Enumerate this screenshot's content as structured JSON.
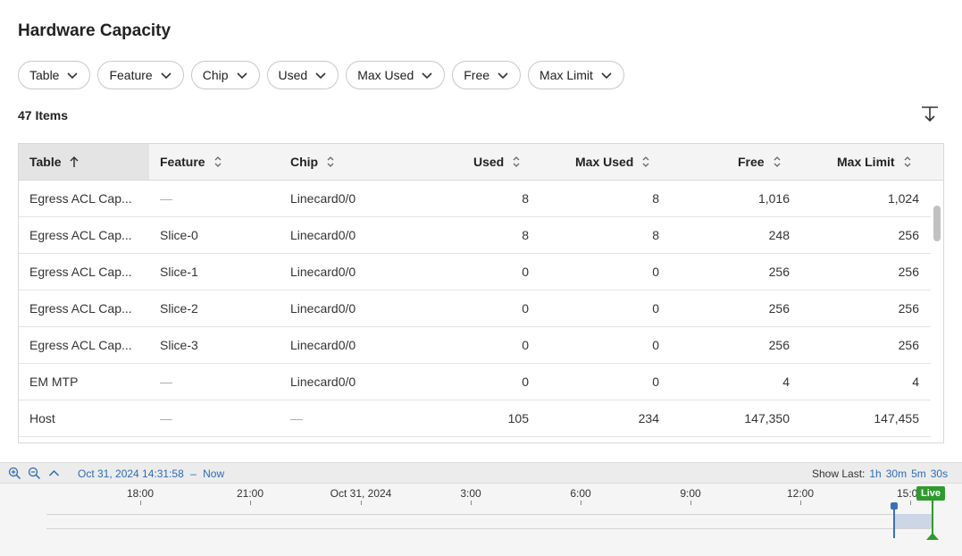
{
  "page": {
    "title": "Hardware Capacity"
  },
  "filters": [
    {
      "label": "Table"
    },
    {
      "label": "Feature"
    },
    {
      "label": "Chip"
    },
    {
      "label": "Used"
    },
    {
      "label": "Max Used"
    },
    {
      "label": "Free"
    },
    {
      "label": "Max Limit"
    }
  ],
  "items_count": "47 Items",
  "table": {
    "columns": [
      {
        "label": "Table",
        "sort": "ascending"
      },
      {
        "label": "Feature",
        "sort": "none"
      },
      {
        "label": "Chip",
        "sort": "none"
      },
      {
        "label": "Used",
        "sort": "none"
      },
      {
        "label": "Max Used",
        "sort": "none"
      },
      {
        "label": "Free",
        "sort": "none"
      },
      {
        "label": "Max Limit",
        "sort": "none"
      }
    ],
    "rows": [
      [
        "Egress ACL Cap...",
        "—",
        "Linecard0/0",
        "8",
        "8",
        "1,016",
        "1,024"
      ],
      [
        "Egress ACL Cap...",
        "Slice-0",
        "Linecard0/0",
        "8",
        "8",
        "248",
        "256"
      ],
      [
        "Egress ACL Cap...",
        "Slice-1",
        "Linecard0/0",
        "0",
        "0",
        "256",
        "256"
      ],
      [
        "Egress ACL Cap...",
        "Slice-2",
        "Linecard0/0",
        "0",
        "0",
        "256",
        "256"
      ],
      [
        "Egress ACL Cap...",
        "Slice-3",
        "Linecard0/0",
        "0",
        "0",
        "256",
        "256"
      ],
      [
        "EM MTP",
        "—",
        "Linecard0/0",
        "0",
        "0",
        "4",
        "4"
      ],
      [
        "Host",
        "—",
        "—",
        "105",
        "234",
        "147,350",
        "147,455"
      ]
    ]
  },
  "timeline": {
    "range_start": "Oct 31, 2024 14:31:58",
    "range_sep": "–",
    "range_end": "Now",
    "show_last_label": "Show Last:",
    "show_last_options": [
      "1h",
      "30m",
      "5m",
      "30s"
    ],
    "ticks": [
      "18:00",
      "21:00",
      "Oct 31, 2024",
      "3:00",
      "6:00",
      "9:00",
      "12:00",
      "15:00"
    ],
    "live_label": "Live"
  },
  "colors": {
    "accent": "#2d6bb4",
    "live": "#2e9a2e",
    "selection": "#cdd6e6"
  },
  "icons": {
    "zoom_in": "zoom-in-icon",
    "zoom_out": "zoom-out-icon",
    "collapse": "chevron-up-icon",
    "download": "download-icon",
    "filter_chevron": "chevron-down-icon",
    "sort_asc": "arrow-up-icon",
    "sort_none": "sort-icon"
  }
}
